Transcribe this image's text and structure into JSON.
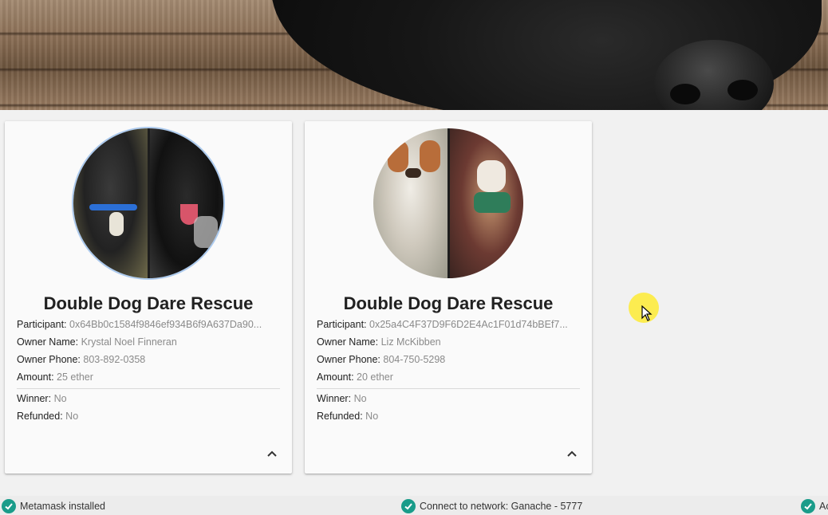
{
  "theme": {
    "accent": "#1a9c8a",
    "card_bg": "#fafafa",
    "value_color": "#8a8a8a"
  },
  "labels": {
    "participant": "Participant:",
    "owner_name": "Owner Name:",
    "owner_phone": "Owner Phone:",
    "amount": "Amount:",
    "winner": "Winner:",
    "refunded": "Refunded:"
  },
  "cards": [
    {
      "title": "Double Dog Dare Rescue",
      "participant": "0x64Bb0c1584f9846ef934B6f9A637Da90...",
      "owner_name": "Krystal Noel Finneran",
      "owner_phone": "803-892-0358",
      "amount": "25 ether",
      "winner": "No",
      "refunded": "No",
      "photo_icon": "dog-photo"
    },
    {
      "title": "Double Dog Dare Rescue",
      "participant": "0x25a4C4F37D9F6D2E4Ac1F01d74bBEf7...",
      "owner_name": "Liz McKibben",
      "owner_phone": "804-750-5298",
      "amount": "20 ether",
      "winner": "No",
      "refunded": "No",
      "photo_icon": "dog-photo"
    }
  ],
  "status_bar": [
    {
      "label": "Metamask installed",
      "icon": "check-circle-icon"
    },
    {
      "label": "Connect to network: Ganache - 5777",
      "icon": "check-circle-icon"
    },
    {
      "label": "Ac",
      "icon": "check-circle-icon"
    }
  ]
}
